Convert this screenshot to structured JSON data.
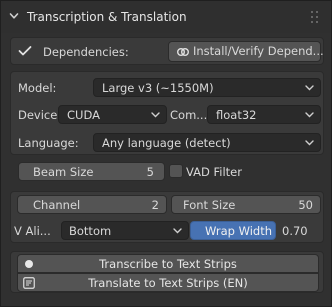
{
  "panel": {
    "title": "Transcription & Translation"
  },
  "dependencies": {
    "label": "Dependencies:",
    "button": "Install/Verify Depend..."
  },
  "model": {
    "label": "Model:",
    "value": "Large v3 (~1550M)"
  },
  "device": {
    "label": "Device:",
    "value": "CUDA",
    "compute_label": "Com...",
    "compute_value": "float32"
  },
  "language": {
    "label": "Language:",
    "value": "Any language (detect)"
  },
  "beam": {
    "label": "Beam Size",
    "value": "5"
  },
  "vad": {
    "label": "VAD Filter",
    "checked": false
  },
  "channel": {
    "label": "Channel",
    "value": "2"
  },
  "font_size": {
    "label": "Font Size",
    "value": "50"
  },
  "v_align": {
    "label": "V Ali...",
    "value": "Bottom"
  },
  "wrap_width": {
    "label": "Wrap Width",
    "value": "0.70"
  },
  "actions": {
    "transcribe": "Transcribe to Text Strips",
    "translate": "Translate to Text Strips (EN)"
  },
  "colors": {
    "accent_blue": "#4772b3",
    "panel_bg": "#303030",
    "field_bg": "#2a2a2a",
    "button_bg": "#545454"
  }
}
